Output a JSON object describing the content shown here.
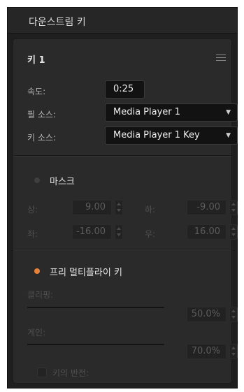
{
  "header": {
    "title": "다운스트림 키"
  },
  "key": {
    "title": "키 1",
    "rate_label": "속도:",
    "rate_value": "0:25",
    "fill_label": "필 소스:",
    "fill_value": "Media Player 1",
    "key_source_label": "키 소스:",
    "key_source_value": "Media Player 1 Key"
  },
  "mask": {
    "label": "마스크",
    "enabled": false,
    "top_label": "상:",
    "top_value": "9.00",
    "bottom_label": "하:",
    "bottom_value": "-9.00",
    "left_label": "좌:",
    "left_value": "-16.00",
    "right_label": "우:",
    "right_value": "16.00"
  },
  "premultiply": {
    "label": "프리 멀티플라이 키",
    "enabled": true,
    "clip_label": "클리핑:",
    "clip_value": "50.0%",
    "clip_level": 0.5,
    "gain_label": "게인:",
    "gain_value": "70.0%",
    "gain_level": 0.7,
    "invert_label": "키의 반전:"
  },
  "colors": {
    "accent": "#e8813a",
    "panel_bg": "#2a2a2a",
    "field_bg": "#121212"
  },
  "icons": {
    "menu": "hamburger-menu-icon",
    "dropdown": "chevron-down-icon",
    "stepper": "up-down-stepper-icon"
  }
}
